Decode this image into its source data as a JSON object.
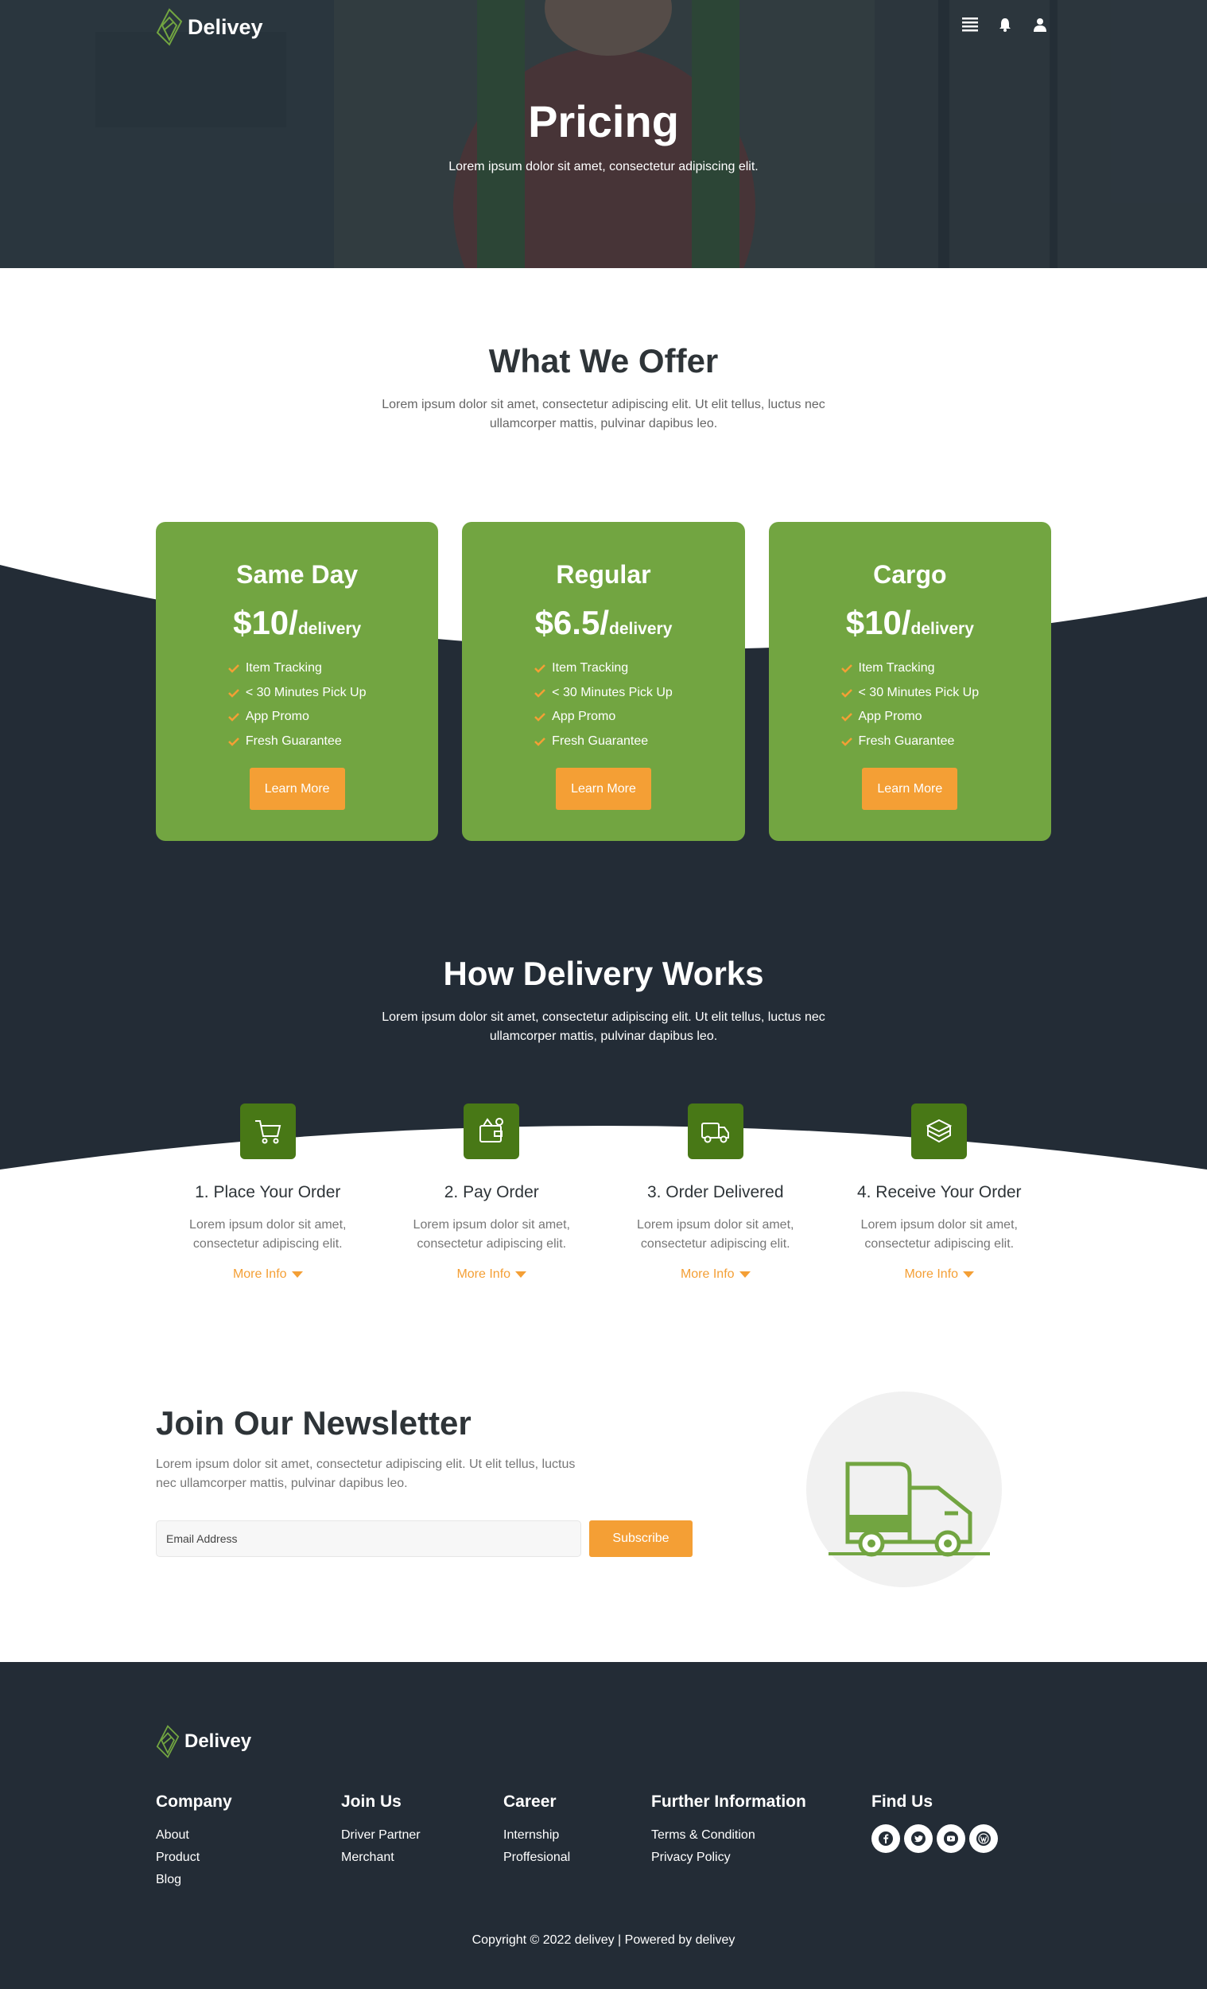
{
  "brand": {
    "name": "Delivey"
  },
  "colors": {
    "green": "#72a541",
    "dark_green": "#487816",
    "orange": "#f49f35",
    "dark": "#232c36"
  },
  "nav": {
    "icons": [
      "menu-icon",
      "bell-icon",
      "user-icon"
    ]
  },
  "hero": {
    "title": "Pricing",
    "subtitle": "Lorem ipsum dolor sit amet, consectetur adipiscing elit."
  },
  "offer": {
    "title": "What We Offer",
    "description": "Lorem ipsum dolor sit amet, consectetur adipiscing elit. Ut elit tellus, luctus nec ullamcorper mattis, pulvinar dapibus leo.",
    "plans": [
      {
        "name": "Same Day",
        "price": "$10/",
        "unit": "delivery",
        "features": [
          "Item Tracking",
          "< 30 Minutes Pick Up",
          "App Promo",
          "Fresh Guarantee"
        ],
        "button": "Learn More"
      },
      {
        "name": "Regular",
        "price": "$6.5/",
        "unit": "delivery",
        "features": [
          "Item Tracking",
          "< 30 Minutes Pick Up",
          "App Promo",
          "Fresh Guarantee"
        ],
        "button": "Learn More"
      },
      {
        "name": "Cargo",
        "price": "$10/",
        "unit": "delivery",
        "features": [
          "Item Tracking",
          "< 30 Minutes Pick Up",
          "App Promo",
          "Fresh Guarantee"
        ],
        "button": "Learn More"
      }
    ]
  },
  "how": {
    "title": "How Delivery Works",
    "description": "Lorem ipsum dolor sit amet, consectetur adipiscing elit. Ut elit tellus, luctus nec ullamcorper mattis, pulvinar dapibus leo.",
    "steps": [
      {
        "icon": "cart-icon",
        "title": "1. Place Your Order",
        "desc": "Lorem ipsum dolor sit amet, consectetur adipiscing elit.",
        "link": "More Info"
      },
      {
        "icon": "wallet-icon",
        "title": "2. Pay Order",
        "desc": "Lorem ipsum dolor sit amet, consectetur adipiscing elit.",
        "link": "More Info"
      },
      {
        "icon": "truck-icon",
        "title": "3. Order Delivered",
        "desc": "Lorem ipsum dolor sit amet, consectetur adipiscing elit.",
        "link": "More Info"
      },
      {
        "icon": "box-icon",
        "title": "4. Receive Your Order",
        "desc": "Lorem ipsum dolor sit amet, consectetur adipiscing elit.",
        "link": "More Info"
      }
    ]
  },
  "newsletter": {
    "title": "Join Our Newsletter",
    "description": "Lorem ipsum dolor sit amet, consectetur adipiscing elit. Ut elit tellus, luctus nec ullamcorper mattis, pulvinar dapibus leo.",
    "placeholder": "Email Address",
    "button": "Subscribe"
  },
  "footer": {
    "company": {
      "title": "Company",
      "links": [
        "About",
        "Product",
        "Blog"
      ]
    },
    "join": {
      "title": "Join Us",
      "links": [
        "Driver Partner",
        "Merchant"
      ]
    },
    "career": {
      "title": "Career",
      "links": [
        "Internship",
        "Proffesional"
      ]
    },
    "info": {
      "title": "Further Information",
      "links": [
        "Terms & Condition",
        "Privacy Policy"
      ]
    },
    "find": {
      "title": "Find Us",
      "social": [
        "facebook-icon",
        "twitter-icon",
        "youtube-icon",
        "wordpress-icon"
      ]
    },
    "copyright": "Copyright © 2022 delivey | Powered by delivey"
  }
}
